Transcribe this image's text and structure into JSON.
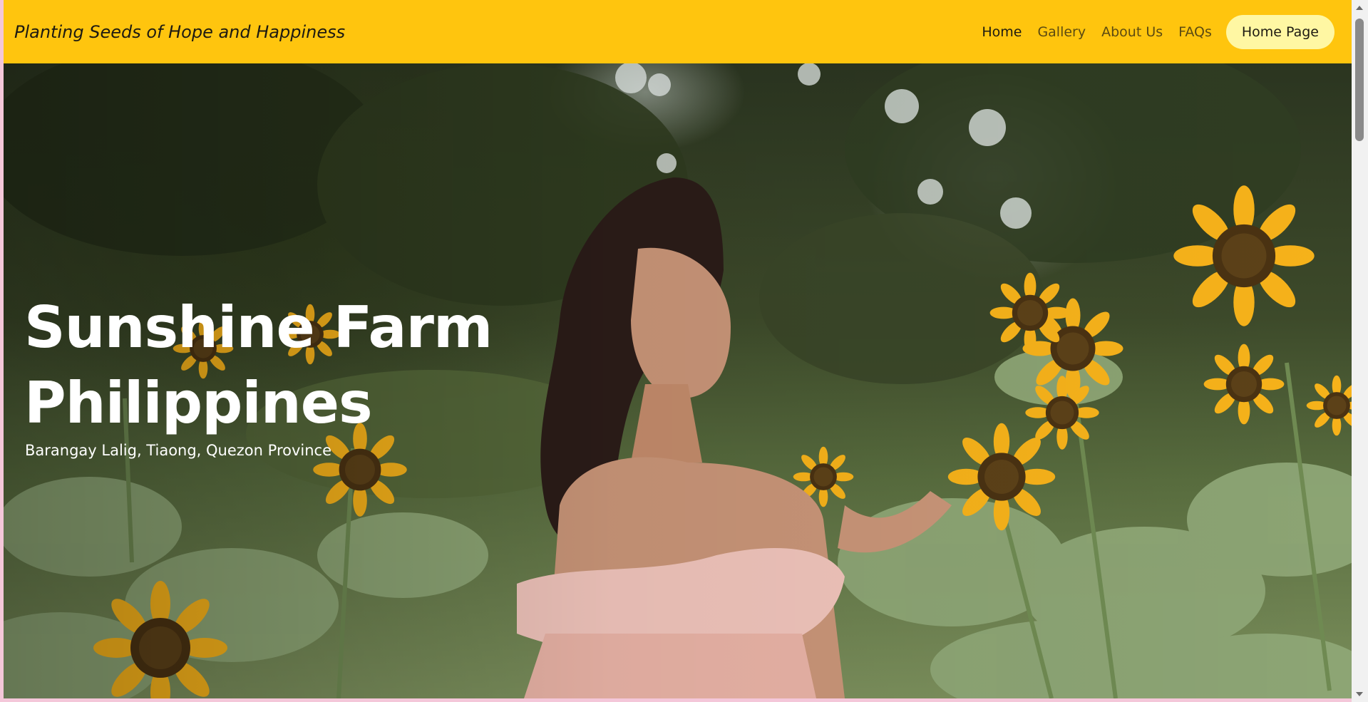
{
  "navbar": {
    "brand": "Planting Seeds of Hope and Happiness",
    "links": [
      {
        "label": "Home",
        "active": true
      },
      {
        "label": "Gallery",
        "active": false
      },
      {
        "label": "About Us",
        "active": false
      },
      {
        "label": "FAQs",
        "active": false
      }
    ],
    "cta_label": "Home Page",
    "background_color": "#ffc50e",
    "cta_color": "#fff7a3"
  },
  "hero": {
    "title": "Sunshine Farm Philippines",
    "subtitle": "Barangay Lalig, Tiaong, Quezon Province",
    "image": "woman-in-sunflower-field-photo"
  },
  "scrollbar": {
    "icons": [
      "scroll-up-arrow",
      "scroll-down-arrow"
    ]
  }
}
